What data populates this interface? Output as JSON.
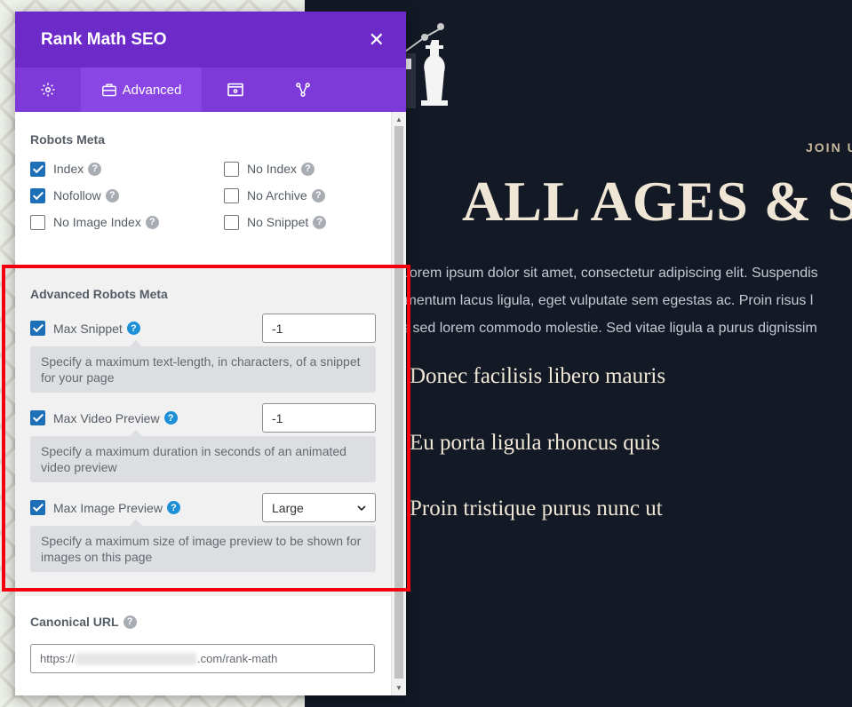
{
  "panel": {
    "title": "Rank Math SEO",
    "close_icon": "✕",
    "tabs": [
      {
        "icon": "gear-icon",
        "label": ""
      },
      {
        "icon": "briefcase-icon",
        "label": "Advanced"
      },
      {
        "icon": "browser-window-icon",
        "label": ""
      },
      {
        "icon": "schema-nodes-icon",
        "label": ""
      }
    ]
  },
  "robots": {
    "title": "Robots Meta",
    "items": [
      {
        "label": "Index",
        "checked": true
      },
      {
        "label": "No Index",
        "checked": false
      },
      {
        "label": "Nofollow",
        "checked": true
      },
      {
        "label": "No Archive",
        "checked": false
      },
      {
        "label": "No Image Index",
        "checked": false
      },
      {
        "label": "No Snippet",
        "checked": false
      }
    ]
  },
  "advanced": {
    "title": "Advanced Robots Meta",
    "max_snippet": {
      "label": "Max Snippet",
      "checked": true,
      "value": "-1",
      "desc": "Specify a maximum text-length, in characters, of a snippet for your page"
    },
    "max_video": {
      "label": "Max Video Preview",
      "checked": true,
      "value": "-1",
      "desc": "Specify a maximum duration in seconds of an animated video preview"
    },
    "max_image": {
      "label": "Max Image Preview",
      "checked": true,
      "value": "Large",
      "desc": "Specify a maximum size of image preview to be shown for images on this page"
    }
  },
  "canonical": {
    "title": "Canonical URL",
    "prefix": "https://",
    "suffix": ".com/rank-math"
  },
  "site": {
    "eyebrow": "JOIN U",
    "hero": "ALL AGES & S",
    "paragraph": [
      "Lorem ipsum dolor sit amet, consectetur adipiscing elit. Suspendis",
      "imentum lacus ligula, eget vulputate sem egestas ac. Proin risus l",
      "s sed lorem commodo molestie. Sed vitae ligula a purus dignissim"
    ],
    "list": [
      "Donec facilisis libero mauris",
      "Eu porta ligula rhoncus quis",
      "Proin tristique purus nunc ut"
    ]
  },
  "colors": {
    "header": "#6c2bc9",
    "tabs": "#7d3ad8",
    "checkbox": "#1d70b8",
    "highlight": "#f5000f"
  }
}
